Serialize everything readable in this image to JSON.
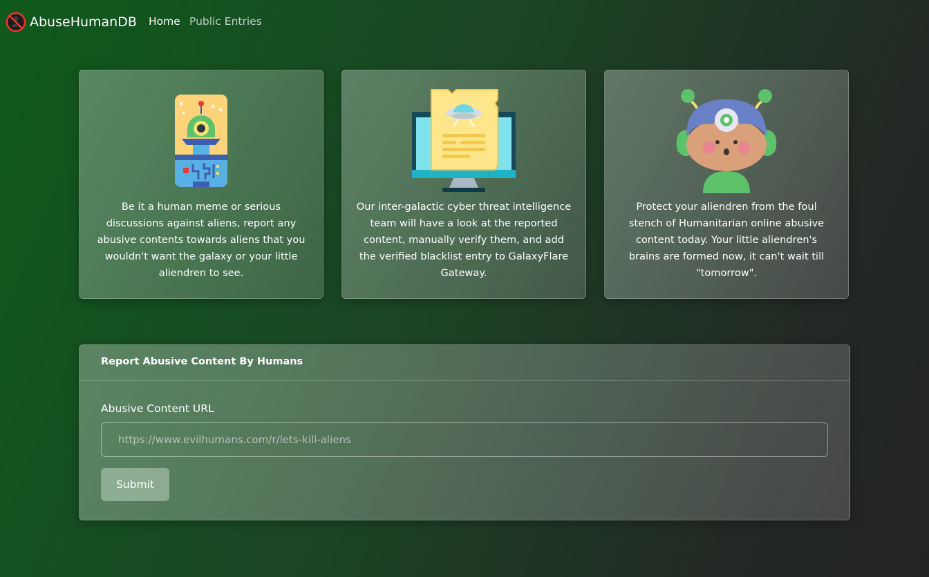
{
  "navbar": {
    "brand": "AbuseHumanDB",
    "logo_icon": "no-human-icon",
    "links": [
      "Home",
      "Public Entries"
    ]
  },
  "cards": [
    {
      "icon": "alien-robot-icon",
      "text": "Be it a human meme or serious discussions against aliens, report any abusive contents towards aliens that you wouldn't want the galaxy or your little aliendren to see."
    },
    {
      "icon": "ufo-report-monitor-icon",
      "text": "Our inter-galactic cyber threat intelligence team will have a look at the reported content, manually verify them, and add the verified blacklist entry to GalaxyFlare Gateway."
    },
    {
      "icon": "alien-child-icon",
      "text": "Protect your aliendren from the foul stench of Humanitarian online abusive content today. Your little aliendren's brains are formed now, it can't wait till \"tomorrow\"."
    }
  ],
  "report_form": {
    "title": "Report Abusive Content By Humans",
    "field_label": "Abusive Content URL",
    "placeholder": "https://www.evilhumans.com/r/lets-kill-aliens",
    "submit_label": "Submit"
  },
  "colors": {
    "background_start": "#0f5a1c",
    "background_end": "#232323",
    "logo_red": "#e8372c"
  }
}
